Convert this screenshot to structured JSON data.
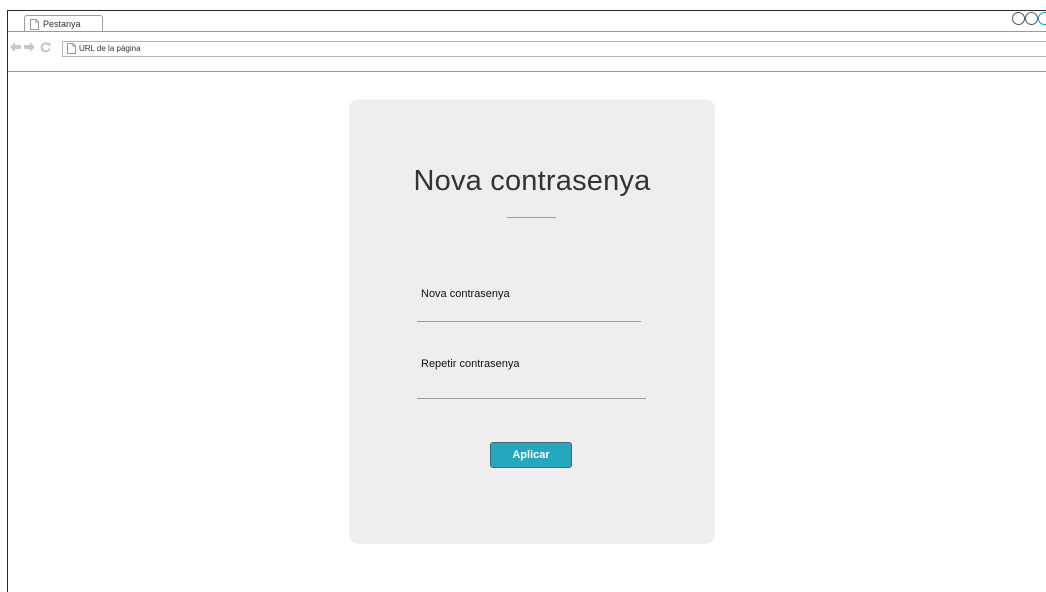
{
  "browser": {
    "tab_label": "Pestanya",
    "url_placeholder": "URL de la pàgina"
  },
  "form": {
    "title": "Nova contrasenya",
    "new_password_label": "Nova contrasenya",
    "repeat_password_label": "Repetir contrasenya",
    "submit_label": "Aplicar"
  },
  "colors": {
    "accent": "#25a7bd",
    "card_background": "#eeeeee"
  }
}
